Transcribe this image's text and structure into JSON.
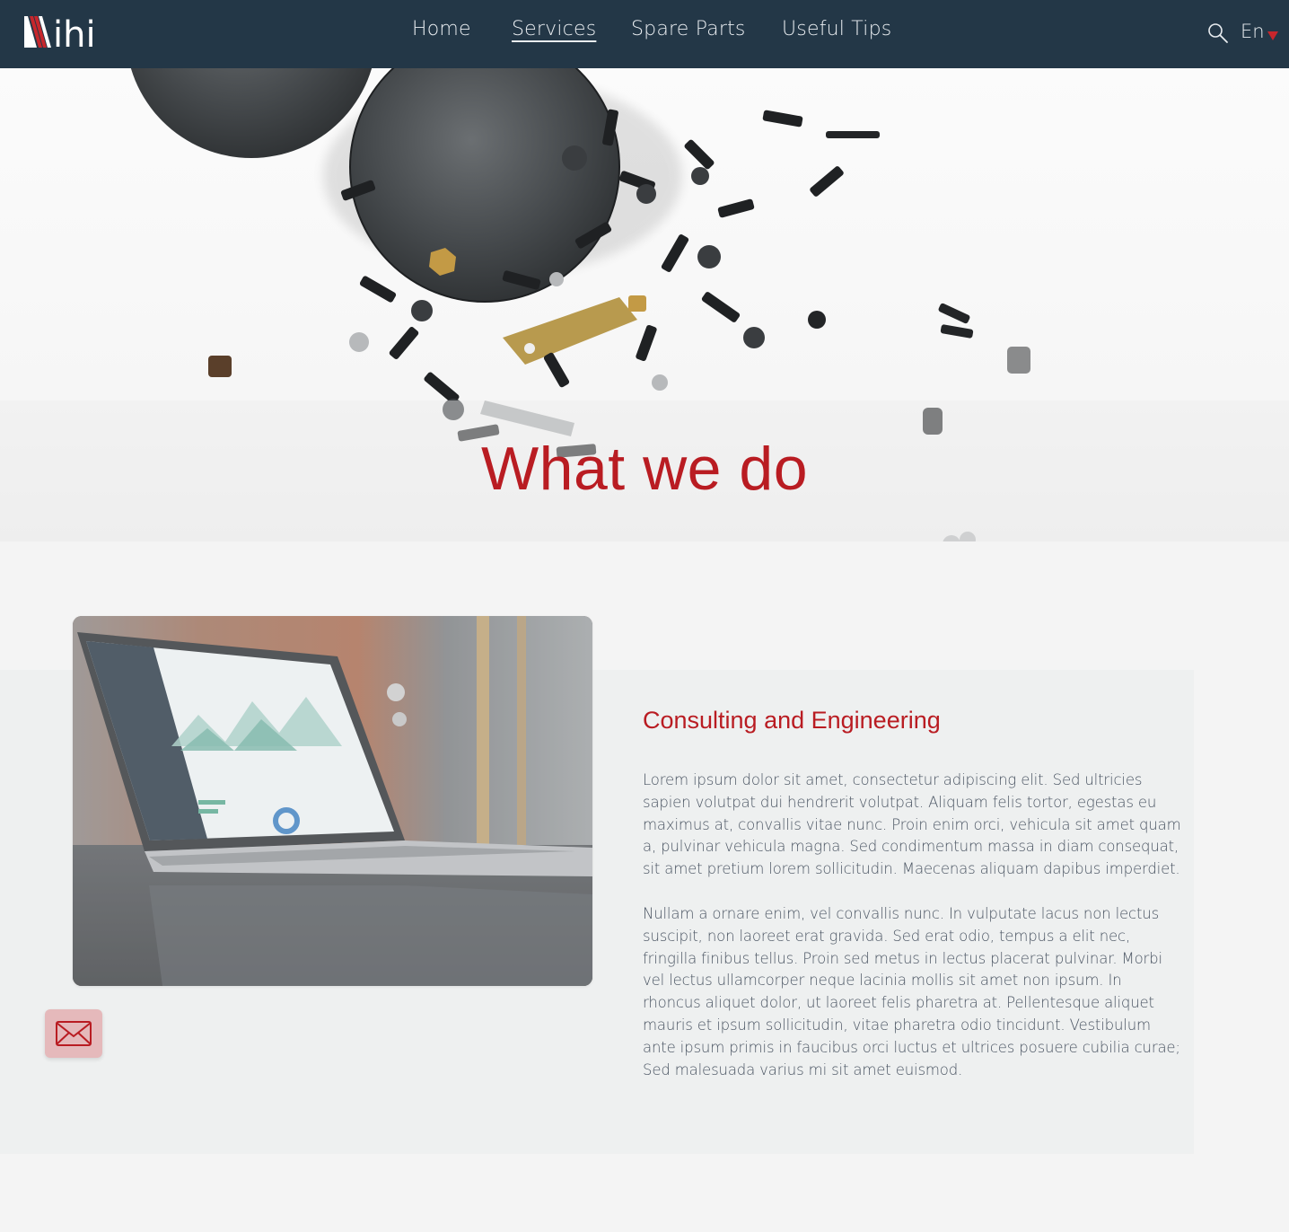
{
  "header": {
    "nav": {
      "home": "Home",
      "services": "Services",
      "spare_parts": "Spare Parts",
      "useful_tips": "Useful Tips",
      "active": "Services"
    },
    "language": "En",
    "icons": {
      "logo": "ihi-logo",
      "search": "search-icon",
      "language_caret": "caret-down-icon"
    }
  },
  "hero": {
    "title": "What we do",
    "image": "scattered-screws-and-metal-parts-photo"
  },
  "service": {
    "title": "Consulting and Engineering",
    "paragraphs": [
      "Lorem ipsum dolor sit amet, consectetur adipiscing elit. Sed ultricies sapien volutpat dui hendrerit volutpat. Aliquam felis tortor, egestas eu maximus at, convallis vitae nunc. Proin enim orci, vehicula sit amet quam a, pulvinar vehicula magna. Sed condimentum massa in diam consequat, sit amet pretium lorem sollicitudin. Maecenas aliquam dapibus imperdiet.",
      "Nullam a ornare enim, vel convallis nunc. In vulputate lacus non lectus suscipit, non laoreet erat gravida. Sed erat odio, tempus a elit nec, fringilla finibus tellus. Proin sed metus in lectus placerat pulvinar. Morbi vel lectus ullamcorper neque lacinia mollis sit amet non ipsum. In rhoncus aliquet dolor, ut laoreet felis pharetra at. Pellentesque aliquet mauris et ipsum sollicitudin, vitae pharetra odio tincidunt. Vestibulum ante ipsum primis in faucibus orci luctus et ultrices posuere cubilia curae; Sed malesuada varius mi sit amet euismod."
    ],
    "image": "laptop-analytics-dashboard-photo"
  },
  "contact": {
    "icon": "envelope-icon"
  },
  "colors": {
    "nav_background": "#233747",
    "accent": "#b91c22",
    "page_background": "#f4f4f4",
    "panel_background": "#eef0f0",
    "mail_button": "#e5b9bb"
  }
}
